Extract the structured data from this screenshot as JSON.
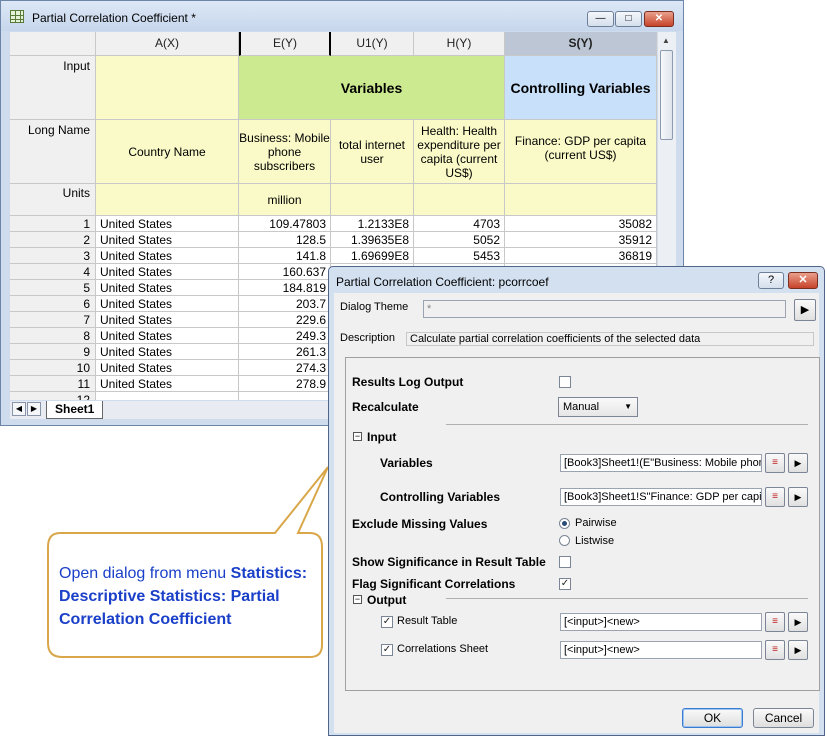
{
  "worksheet": {
    "title": "Partial Correlation Coefficient *",
    "columns": [
      "A(X)",
      "E(Y)",
      "U1(Y)",
      "H(Y)",
      "S(Y)"
    ],
    "row_labels": {
      "input": "Input",
      "long_name": "Long Name",
      "units": "Units"
    },
    "input_variables": "Variables",
    "input_controlling": "Controlling Variables",
    "long_names": [
      "Country Name",
      "Business: Mobile phone subscribers",
      "total internet user",
      "Health: Health expenditure per capita (current US$)",
      "Finance: GDP per capita (current US$)"
    ],
    "units": [
      "",
      "million",
      "",
      "",
      ""
    ],
    "rows": [
      {
        "n": "1",
        "a": "United States",
        "e": "109.47803",
        "u": "1.2133E8",
        "h": "4703",
        "s": "35082"
      },
      {
        "n": "2",
        "a": "United States",
        "e": "128.5",
        "u": "1.39635E8",
        "h": "5052",
        "s": "35912"
      },
      {
        "n": "3",
        "a": "United States",
        "e": "141.8",
        "u": "1.69699E8",
        "h": "5453",
        "s": "36819"
      },
      {
        "n": "4",
        "a": "United States",
        "e": "160.637",
        "u": "",
        "h": "",
        "s": ""
      },
      {
        "n": "5",
        "a": "United States",
        "e": "184.819",
        "u": "",
        "h": "",
        "s": ""
      },
      {
        "n": "6",
        "a": "United States",
        "e": "203.7",
        "u": "",
        "h": "",
        "s": ""
      },
      {
        "n": "7",
        "a": "United States",
        "e": "229.6",
        "u": "",
        "h": "",
        "s": ""
      },
      {
        "n": "8",
        "a": "United States",
        "e": "249.3",
        "u": "",
        "h": "",
        "s": ""
      },
      {
        "n": "9",
        "a": "United States",
        "e": "261.3",
        "u": "",
        "h": "",
        "s": ""
      },
      {
        "n": "10",
        "a": "United States",
        "e": "274.3",
        "u": "",
        "h": "",
        "s": ""
      },
      {
        "n": "11",
        "a": "United States",
        "e": "278.9",
        "u": "",
        "h": "",
        "s": ""
      },
      {
        "n": "12",
        "a": "",
        "e": "",
        "u": "",
        "h": "",
        "s": ""
      }
    ],
    "sheet_tab": "Sheet1"
  },
  "callout": {
    "prefix": "Open dialog from menu ",
    "path": "Statistics: Descriptive Statistics: Partial Correlation Coefficient"
  },
  "dialog": {
    "title": "Partial Correlation Coefficient: pcorrcoef",
    "help_button": "?",
    "dialog_theme_label": "Dialog Theme",
    "dialog_theme_value": "*",
    "description_label": "Description",
    "description_value": "Calculate partial correlation coefficients of the selected data",
    "results_log_output": "Results Log Output",
    "recalculate_label": "Recalculate",
    "recalculate_value": "Manual",
    "input_section": "Input",
    "variables_label": "Variables",
    "variables_value": "[Book3]Sheet1!(E\"Business: Mobile phone",
    "controlling_label": "Controlling Variables",
    "controlling_value": "[Book3]Sheet1!S\"Finance: GDP per capit",
    "exclude_missing_label": "Exclude Missing Values",
    "pairwise_label": "Pairwise",
    "listwise_label": "Listwise",
    "show_significance_label": "Show Significance in Result Table",
    "flag_significant_label": "Flag Significant Correlations",
    "output_section": "Output",
    "result_table_label": "Result Table",
    "result_table_value": "[<input>]<new>",
    "correlations_sheet_label": "Correlations Sheet",
    "correlations_sheet_value": "[<input>]<new>",
    "ok": "OK",
    "cancel": "Cancel"
  }
}
